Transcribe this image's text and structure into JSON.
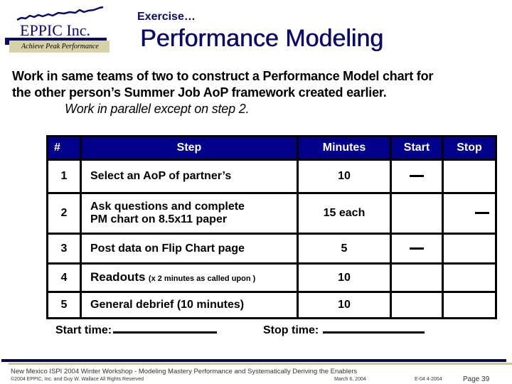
{
  "logo": {
    "company": "EPPIC Inc.",
    "tagline": "Achieve Peak Performance",
    "brand_color": "#0a0a6a",
    "accent_color": "#d6d3a8"
  },
  "header": {
    "kicker": "Exercise…",
    "title": "Performance Modeling"
  },
  "intro": {
    "line1": "Work in same teams of two to construct a Performance Model chart for",
    "line2": "the other person’s Summer Job AoP framework created earlier.",
    "note": "Work in parallel except on step 2."
  },
  "table": {
    "header_color": "#00008b",
    "columns": [
      "#",
      "Step",
      "Minutes",
      "Start",
      "Stop"
    ],
    "rows": [
      {
        "num": "1",
        "step": "Select an AoP of partner’s",
        "step_note": "",
        "minutes": "10",
        "start": "—",
        "stop": ""
      },
      {
        "num": "2",
        "step": "Ask questions and complete",
        "step_line2": "PM chart on 8.5x11 paper",
        "step_note": "",
        "minutes": "15 each",
        "start": "",
        "stop": "—"
      },
      {
        "num": "3",
        "step": "Post data on Flip Chart page",
        "step_note": "",
        "minutes": "5",
        "start": "—",
        "stop": ""
      },
      {
        "num": "4",
        "step": "Readouts",
        "step_note": "(x 2 minutes as called upon )",
        "minutes": "10",
        "start": "",
        "stop": ""
      },
      {
        "num": "5",
        "step": "General debrief  (10 minutes)",
        "step_note": "",
        "minutes": "10",
        "start": "",
        "stop": ""
      }
    ]
  },
  "times": {
    "start_label": "Start time:",
    "stop_label": "Stop time:"
  },
  "footer": {
    "event": "New Mexico ISPI 2004 Winter Workshop  -  Modeling Mastery Performance and Systematically Deriving the Enablers",
    "copyright": "©2004 EPPIC, Inc. and Guy W. Wallace   All Rights Reserved",
    "date": "March 6, 2004",
    "code": "E-04  4-2004",
    "page": "Page 39"
  }
}
